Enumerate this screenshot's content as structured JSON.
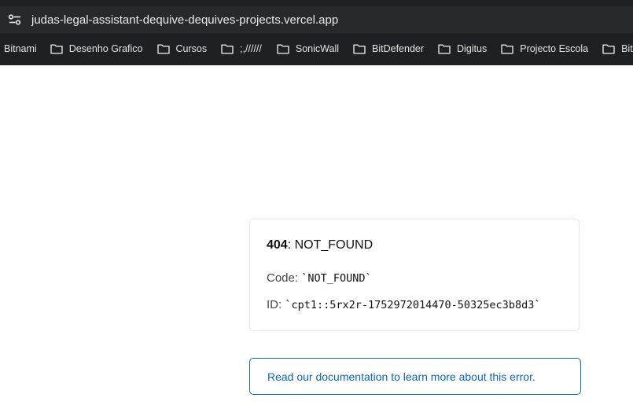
{
  "browser": {
    "url": "judas-legal-assistant-dequive-dequives-projects.vercel.app",
    "site_info_icon": "tune-icon",
    "bookmarks": [
      {
        "label": "Bitnami",
        "folder": false
      },
      {
        "label": "Desenho Grafico",
        "folder": true
      },
      {
        "label": "Cursos",
        "folder": true
      },
      {
        "label": ";,//////",
        "folder": true
      },
      {
        "label": "SonicWall",
        "folder": true
      },
      {
        "label": "BitDefender",
        "folder": true
      },
      {
        "label": "Digitus",
        "folder": true
      },
      {
        "label": "Projecto Escola",
        "folder": true
      },
      {
        "label": "BitCoin",
        "folder": true
      }
    ]
  },
  "error": {
    "code_number": "404",
    "code_text": ": NOT_FOUND",
    "code_label": "Code: ",
    "code_value": "`NOT_FOUND`",
    "id_label": "ID: ",
    "id_value": "`cpt1::5rx2r-1752972014470-50325ec3b8d3`"
  },
  "docs": {
    "link_text": "Read our documentation to learn more about this error."
  },
  "colors": {
    "chrome_bg": "#1f2023",
    "address_bar_bg": "#28292c",
    "link_blue": "#0a64c8",
    "link_border": "#0a6ece"
  }
}
